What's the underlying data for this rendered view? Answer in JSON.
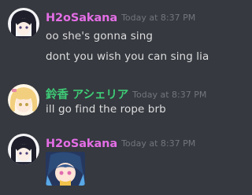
{
  "colors": {
    "background": "#36393f",
    "text": "#dcddde",
    "timestamp": "#72767d",
    "user_h2o": "#e46ee6",
    "user_suzuka": "#3ecb76"
  },
  "messages": [
    {
      "author": "H2oSakana",
      "timestamp": "Today at 8:37 PM",
      "lines": [
        "oo she's gonna sing",
        "dont you wish you can sing lia"
      ]
    },
    {
      "author": "鈴香 アシェリア",
      "timestamp": "Today at 8:37 PM",
      "lines": [
        "ill go find the rope brb"
      ]
    },
    {
      "author": "H2oSakana",
      "timestamp": "Today at 8:37 PM",
      "attachment_icon": "anime-character-image"
    }
  ]
}
